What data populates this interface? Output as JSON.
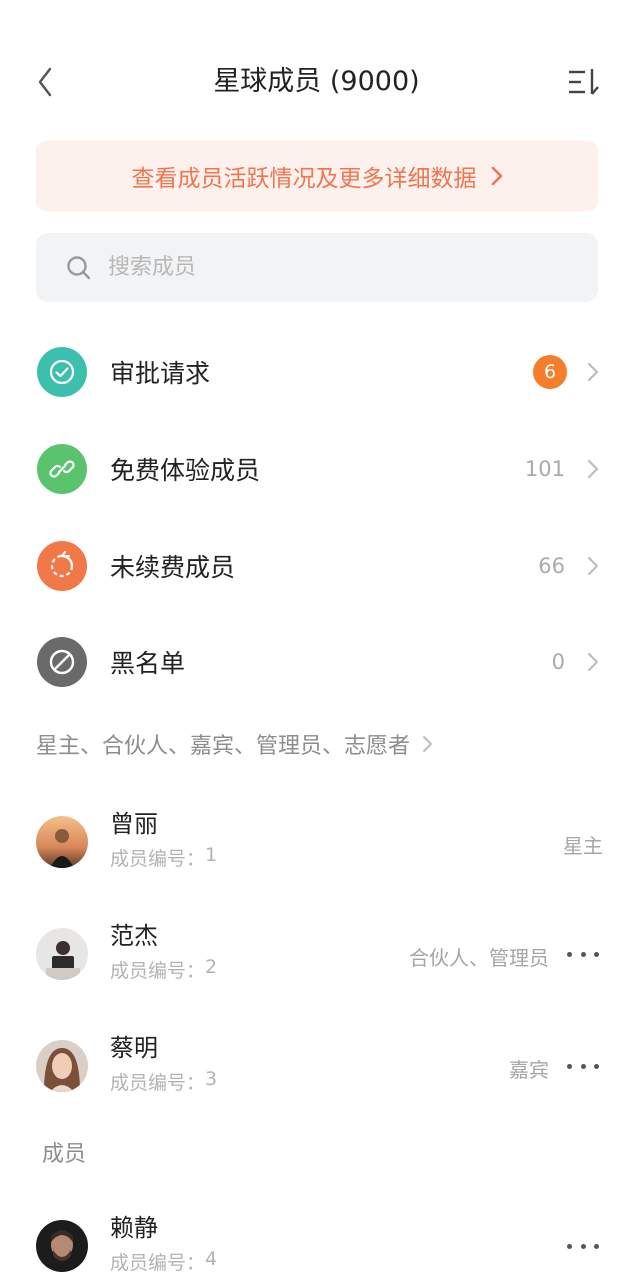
{
  "header": {
    "title": "星球成员 (9000)"
  },
  "banner": {
    "text": "查看成员活跃情况及更多详细数据"
  },
  "search": {
    "placeholder": "搜索成员"
  },
  "menu": [
    {
      "label": "审批请求",
      "badge": "6",
      "icon": "check-icon",
      "color": "#3cc0ad"
    },
    {
      "label": "免费体验成员",
      "count": "101",
      "icon": "link-icon",
      "color": "#5ac36d"
    },
    {
      "label": "未续费成员",
      "count": "66",
      "icon": "refresh-icon",
      "color": "#f07849"
    },
    {
      "label": "黑名单",
      "count": "0",
      "icon": "block-icon",
      "color": "#6a6a6a"
    }
  ],
  "roles_header": "星主、合伙人、嘉宾、管理员、志愿者",
  "members_top": [
    {
      "name": "曾丽",
      "id_label": "成员编号：",
      "id": "1",
      "role": "星主"
    },
    {
      "name": "范杰",
      "id_label": "成员编号：",
      "id": "2",
      "role": "合伙人、管理员"
    },
    {
      "name": "蔡明",
      "id_label": "成员编号：",
      "id": "3",
      "role": "嘉宾"
    }
  ],
  "section_label": "成员",
  "members": [
    {
      "name": "赖静",
      "id_label": "成员编号：",
      "id": "4"
    }
  ]
}
